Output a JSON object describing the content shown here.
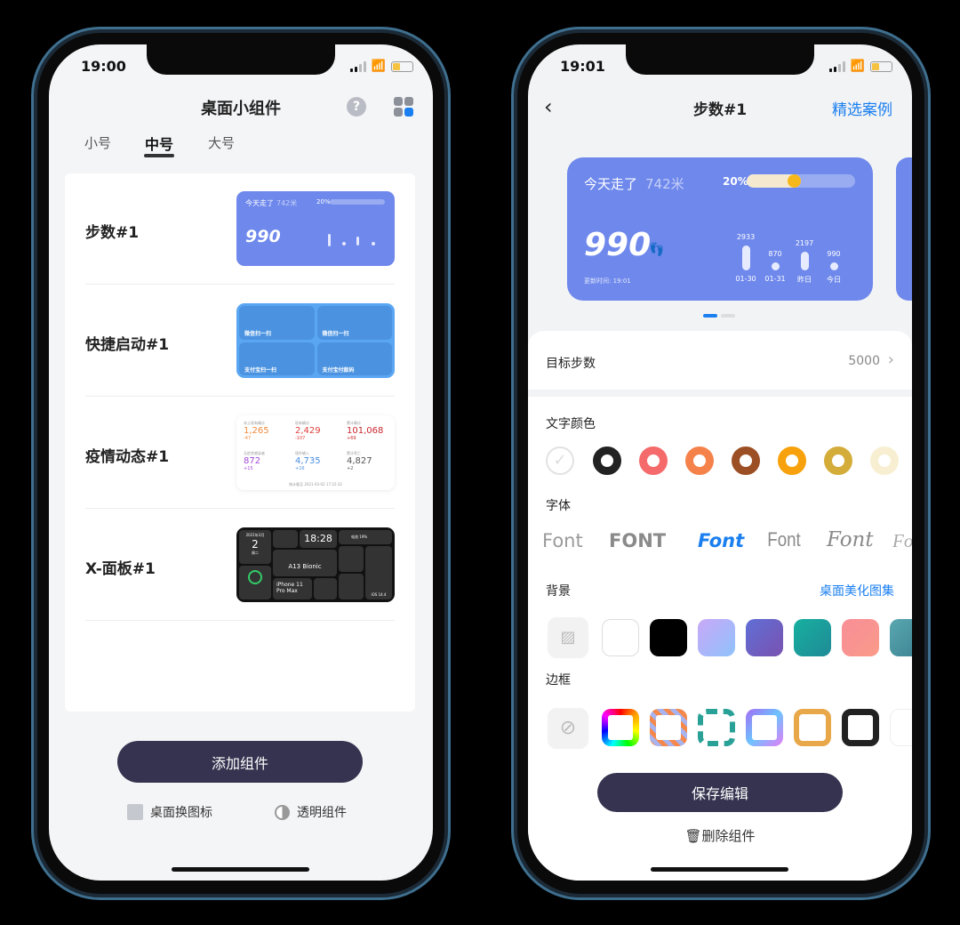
{
  "left": {
    "status_time": "19:00",
    "title": "桌面小组件",
    "tabs": [
      {
        "label": "小号"
      },
      {
        "label": "中号",
        "active": true
      },
      {
        "label": "大号"
      }
    ],
    "widgets": [
      {
        "label": "步数#1"
      },
      {
        "label": "快捷启动#1"
      },
      {
        "label": "疫情动态#1"
      },
      {
        "label": "X-面板#1"
      }
    ],
    "steps_thumb": {
      "walked": "今天走了",
      "distance": "742米",
      "percent": "20%",
      "steps": "990"
    },
    "quick_thumb": [
      "微信扫一扫",
      "微信扫一扫",
      "支付宝扫一扫",
      "支付宝付款码"
    ],
    "covid_thumb": {
      "cells": [
        {
          "label": "本土现有确诊",
          "value": "1,265",
          "delta": "-47",
          "color": "#f08a3c"
        },
        {
          "label": "现有确诊",
          "value": "2,429",
          "delta": "-107",
          "color": "#e0413c"
        },
        {
          "label": "累计确诊",
          "value": "101,068",
          "delta": "+69",
          "color": "#c8282e"
        },
        {
          "label": "无症状感染者",
          "value": "872",
          "delta": "+15",
          "color": "#a24ad6"
        },
        {
          "label": "境外输入",
          "value": "4,735",
          "delta": "+16",
          "color": "#4a8ee0"
        },
        {
          "label": "累计死亡",
          "value": "4,827",
          "delta": "+2",
          "color": "#555555"
        }
      ],
      "footer": "统计截至 2021-03-02 17:22:32"
    },
    "xpanel_thumb": {
      "date": "2021年3月",
      "day": "2",
      "weekday": "周二",
      "time": "18:28",
      "chip": "A13 Bionic",
      "model": "iPhone 11 Pro Max",
      "battery": "电池 19%",
      "os": "iOS 14.4"
    },
    "add_button": "添加组件",
    "change_icon": "桌面换图标",
    "transparent": "透明组件"
  },
  "right": {
    "status_time": "19:01",
    "title": "步数#1",
    "featured": "精选案例",
    "preview": {
      "walked": "今天走了",
      "distance": "742米",
      "percent": "20%",
      "progress": 0.2,
      "steps": "990",
      "updated": "更新时间: 19:01",
      "bars": [
        {
          "value": "2933",
          "label": "01-30"
        },
        {
          "value": "870",
          "label": "01-31"
        },
        {
          "value": "2197",
          "label": "昨日"
        },
        {
          "value": "990",
          "label": "今日"
        }
      ]
    },
    "goal_label": "目标步数",
    "goal_value": "5000",
    "text_color_label": "文字颜色",
    "text_colors": [
      "#222222",
      "#f56a6a",
      "#f5824a",
      "#9c4f24",
      "#f7a20c",
      "#d4ac3a",
      "#f8efd2"
    ],
    "font_label": "字体",
    "fonts": [
      {
        "label": "Font"
      },
      {
        "label": "FONT"
      },
      {
        "label": "Font",
        "selected": true
      },
      {
        "label": "Font"
      },
      {
        "label": "Font"
      },
      {
        "label": "Fo"
      }
    ],
    "bg_label": "背景",
    "bg_gallery": "桌面美化图集",
    "bg_swatches": [
      "#ffffff",
      "#000000",
      "linear-gradient(135deg,#c9a8f8,#8fc2fb)",
      "linear-gradient(135deg,#5f6fd6,#7a52b0)",
      "linear-gradient(135deg,#17b0a0,#1f8a96)",
      "linear-gradient(135deg,#f78e97,#fa9a8a)",
      "linear-gradient(135deg,#5aa8b0,#3a7f90)"
    ],
    "border_label": "边框",
    "save_button": "保存编辑",
    "delete": "删除组件",
    "accent": "#1a7ff0"
  }
}
